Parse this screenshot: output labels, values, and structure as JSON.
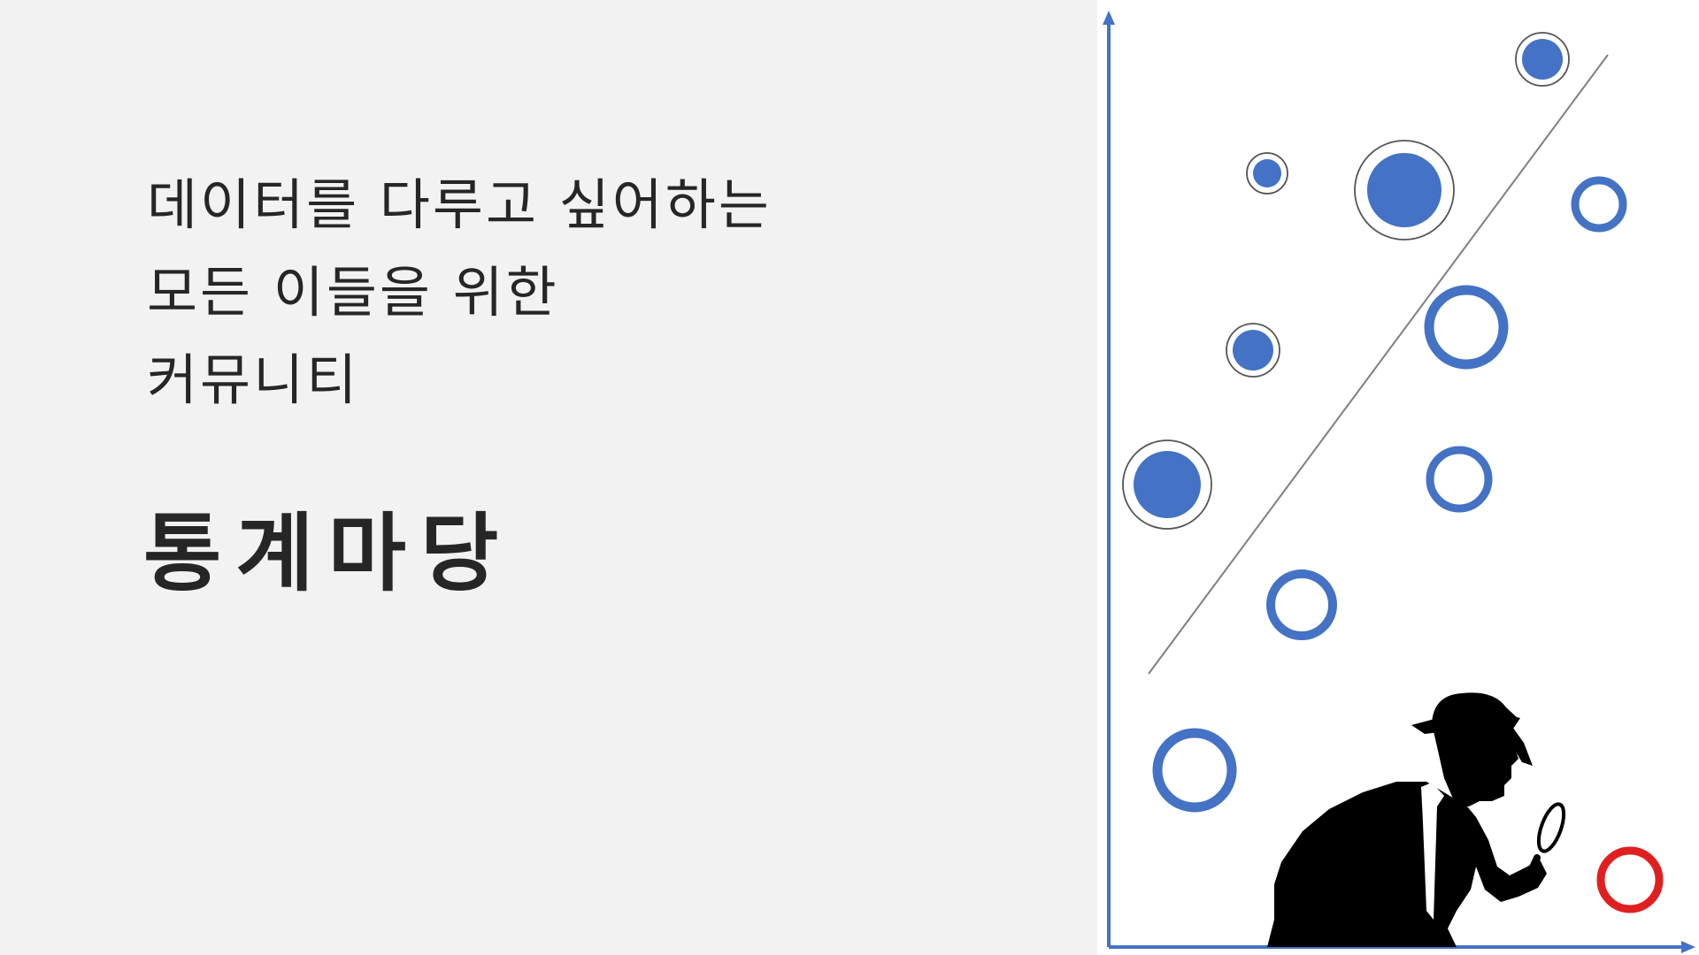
{
  "tagline": {
    "line1": "데이터를 다루고 싶어하는",
    "line2": "모든 이들을 위한",
    "line3": "커뮤니티"
  },
  "brand": {
    "name": "통계마당"
  },
  "illustration": {
    "icon": "detective-with-magnifier",
    "colors": {
      "axis": "#4472c4",
      "filled": "#4472c4",
      "ring": "#4472c4",
      "highlight": "#e02020",
      "line": "#7f7f7f",
      "silhouette": "#000000"
    }
  }
}
